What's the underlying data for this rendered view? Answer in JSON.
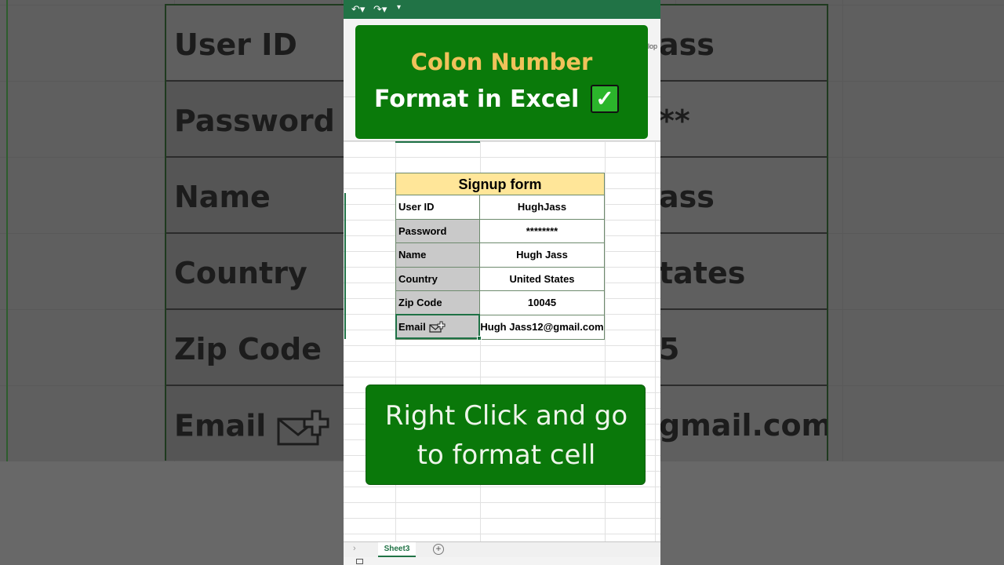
{
  "background": {
    "rows": [
      {
        "label": "User ID",
        "value": "ass"
      },
      {
        "label": "Password",
        "value": "**"
      },
      {
        "label": "Name",
        "value": "ass"
      },
      {
        "label": "Country",
        "value": "tates"
      },
      {
        "label": "Zip Code",
        "value": "5"
      },
      {
        "label": "Email",
        "value": "gmail.com"
      }
    ]
  },
  "ribbon": {
    "right_text": "lop"
  },
  "banner": {
    "line1": "Colon Number",
    "line2": "Format in Excel",
    "check": "✓"
  },
  "form": {
    "title": "Signup form",
    "rows": [
      {
        "label": "User ID",
        "value": "HughJass"
      },
      {
        "label": "Password",
        "value": "********"
      },
      {
        "label": "Name",
        "value": "Hugh Jass"
      },
      {
        "label": "Country",
        "value": "United States"
      },
      {
        "label": "Zip Code",
        "value": "10045"
      },
      {
        "label": "Email",
        "value": "Hugh Jass12@gmail.com"
      }
    ]
  },
  "tip": {
    "line1": "Right Click and go",
    "line2": "to format cell"
  },
  "sheet_tab": "Sheet3",
  "colors": {
    "excel_green": "#217346",
    "banner_green": "#0a7a0a",
    "title_fill": "#ffe699",
    "label_fill": "#c9c9c9",
    "banner_gold": "#f0c25a"
  },
  "icons": [
    "undo-icon",
    "redo-icon",
    "customize-icon",
    "envelope-plus-icon",
    "add-sheet-icon",
    "check-icon"
  ]
}
